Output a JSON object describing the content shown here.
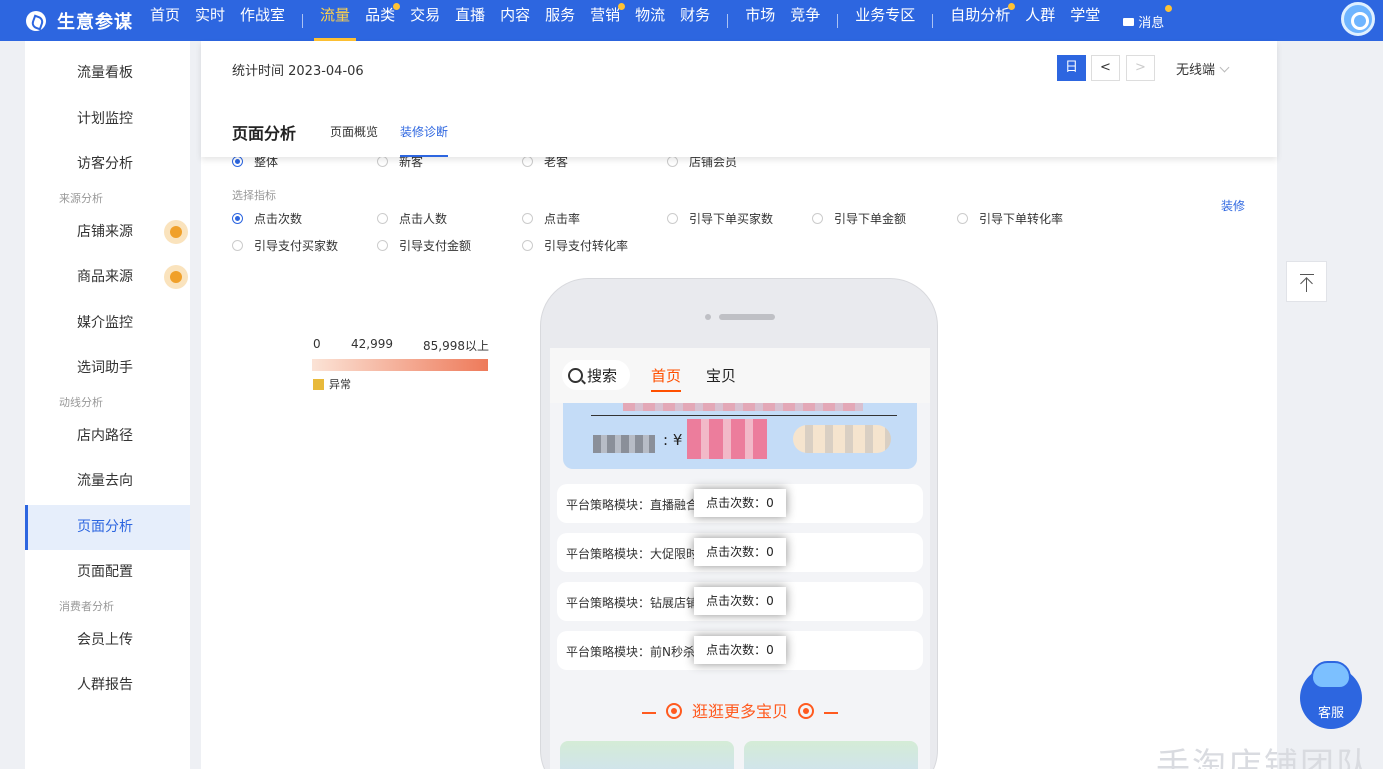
{
  "brand": {
    "name": "生意参谋"
  },
  "nav": {
    "items": [
      {
        "label": "首页",
        "dot": false,
        "active": false
      },
      {
        "label": "实时",
        "dot": false,
        "active": false
      },
      {
        "label": "作战室",
        "dot": false,
        "active": false,
        "sep_after": true
      },
      {
        "label": "流量",
        "dot": false,
        "active": true
      },
      {
        "label": "品类",
        "dot": true,
        "active": false
      },
      {
        "label": "交易",
        "dot": false,
        "active": false
      },
      {
        "label": "直播",
        "dot": false,
        "active": false
      },
      {
        "label": "内容",
        "dot": false,
        "active": false
      },
      {
        "label": "服务",
        "dot": false,
        "active": false
      },
      {
        "label": "营销",
        "dot": true,
        "active": false
      },
      {
        "label": "物流",
        "dot": false,
        "active": false
      },
      {
        "label": "财务",
        "dot": false,
        "active": false,
        "sep_after": true
      },
      {
        "label": "市场",
        "dot": false,
        "active": false
      },
      {
        "label": "竞争",
        "dot": false,
        "active": false,
        "sep_after": true
      },
      {
        "label": "业务专区",
        "dot": false,
        "active": false,
        "sep_after": true
      },
      {
        "label": "自助分析",
        "dot": true,
        "active": false
      },
      {
        "label": "人群",
        "dot": false,
        "active": false
      },
      {
        "label": "学堂",
        "dot": false,
        "active": false
      }
    ],
    "message_label": "消息"
  },
  "sidebar": {
    "items": [
      {
        "label": "流量看板",
        "badge": false
      },
      {
        "label": "计划监控",
        "badge": false
      },
      {
        "label": "访客分析",
        "badge": false
      },
      {
        "group": "来源分析"
      },
      {
        "label": "店铺来源",
        "badge": true
      },
      {
        "label": "商品来源",
        "badge": true
      },
      {
        "label": "媒介监控",
        "badge": false
      },
      {
        "label": "选词助手",
        "badge": false
      },
      {
        "group": "动线分析"
      },
      {
        "label": "店内路径",
        "badge": false
      },
      {
        "label": "流量去向",
        "badge": false
      },
      {
        "label": "页面分析",
        "badge": false,
        "active": true
      },
      {
        "label": "页面配置",
        "badge": false
      },
      {
        "group": "消费者分析"
      },
      {
        "label": "会员上传",
        "badge": false
      },
      {
        "label": "人群报告",
        "badge": false
      }
    ]
  },
  "header": {
    "stat_time": "统计时间 2023-04-06",
    "day_label": "日",
    "prev_label": "<",
    "next_label": ">",
    "device": "无线端",
    "page_title": "页面分析",
    "tabs": [
      {
        "label": "页面概览",
        "active": false
      },
      {
        "label": "装修诊断",
        "active": true
      }
    ]
  },
  "filters": {
    "crowd_options": [
      {
        "label": "整体",
        "checked": true
      },
      {
        "label": "新客",
        "checked": false
      },
      {
        "label": "老客",
        "checked": false
      },
      {
        "label": "店铺会员",
        "checked": false
      }
    ],
    "metric_label": "选择指标",
    "metrics_row1": [
      {
        "label": "点击次数",
        "checked": true
      },
      {
        "label": "点击人数",
        "checked": false
      },
      {
        "label": "点击率",
        "checked": false
      },
      {
        "label": "引导下单买家数",
        "checked": false
      },
      {
        "label": "引导下单金额",
        "checked": false
      },
      {
        "label": "引导下单转化率",
        "checked": false
      }
    ],
    "metrics_row2": [
      {
        "label": "引导支付买家数",
        "checked": false
      },
      {
        "label": "引导支付金额",
        "checked": false
      },
      {
        "label": "引导支付转化率",
        "checked": false
      }
    ],
    "decorate_link": "装修"
  },
  "legend": {
    "min": "0",
    "mid": "42,999",
    "max": "85,998以上",
    "abnormal_label": "异常",
    "colors": {
      "low": "#fbe3d6",
      "high": "#ee7a5a",
      "abnormal": "#e8b93a"
    }
  },
  "phone": {
    "search_label": "搜索",
    "tabs": [
      {
        "label": "首页",
        "active": true
      },
      {
        "label": "宝贝",
        "active": false
      }
    ],
    "banner_price_prefix": ": ¥",
    "modules": [
      {
        "text": "平台策略模块：直播融合",
        "click_label": "点击次数：0"
      },
      {
        "text": "平台策略模块：大促限时",
        "click_label": "点击次数：0"
      },
      {
        "text": "平台策略模块：钻展店铺",
        "click_label": "点击次数：0"
      },
      {
        "text": "平台策略模块：前N秒杀",
        "click_label": "点击次数：0"
      }
    ],
    "more_label": "逛逛更多宝贝"
  },
  "floating": {
    "customer_service": "客服",
    "watermark": "手淘店铺团队"
  },
  "colors": {
    "brand": "#2d66e0",
    "nav_active": "#ffd24a",
    "accent_orange": "#ff5000"
  }
}
